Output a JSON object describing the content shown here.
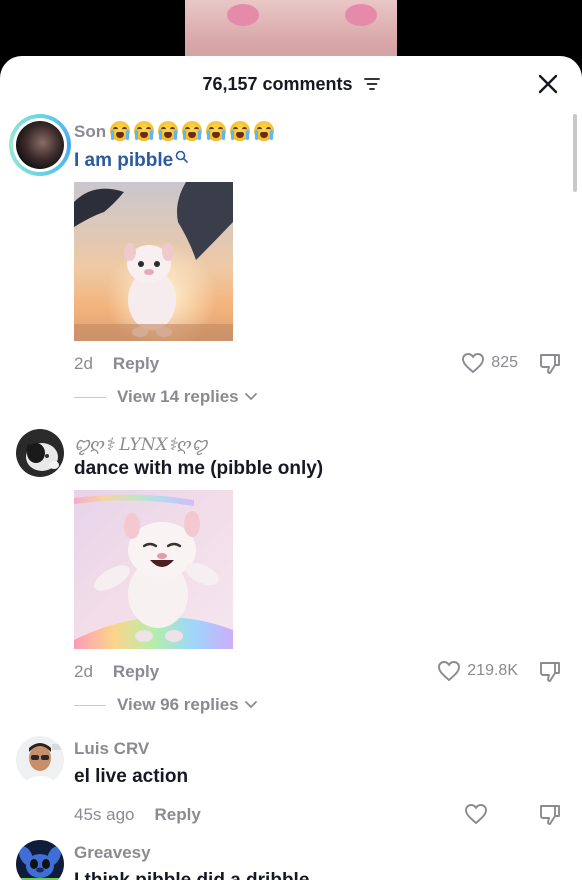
{
  "header": {
    "comment_count": "76,157 comments",
    "sort_icon": "sort-icon",
    "close_icon": "close-icon"
  },
  "comments": [
    {
      "username": "Son",
      "username_emoji": "loudly-crying-face x7",
      "text": "I am pibble",
      "has_photo": true,
      "photo": "french-bulldog-dancing-with-dolphins-sunset",
      "time": "2d",
      "reply_label": "Reply",
      "likes": "825",
      "view_replies": "View 14 replies"
    },
    {
      "username": "ꨄ︎ღ⚕︎ LYNX⚕︎ღꨄ︎",
      "text": "dance with me (pibble only)",
      "has_photo": true,
      "photo": "french-bulldog-dancing-rainbow",
      "time": "2d",
      "reply_label": "Reply",
      "likes": "219.8K",
      "view_replies": "View 96 replies"
    },
    {
      "username": "Luis CRV",
      "text": "el live action",
      "time": "45s ago",
      "reply_label": "Reply",
      "likes": ""
    },
    {
      "username": "Greavesy",
      "text": "I think pibble did a dribble"
    }
  ],
  "colors": {
    "text_primary": "#161823",
    "text_secondary": "#8a8b91",
    "link": "#2c5aa0",
    "background": "#ffffff"
  }
}
